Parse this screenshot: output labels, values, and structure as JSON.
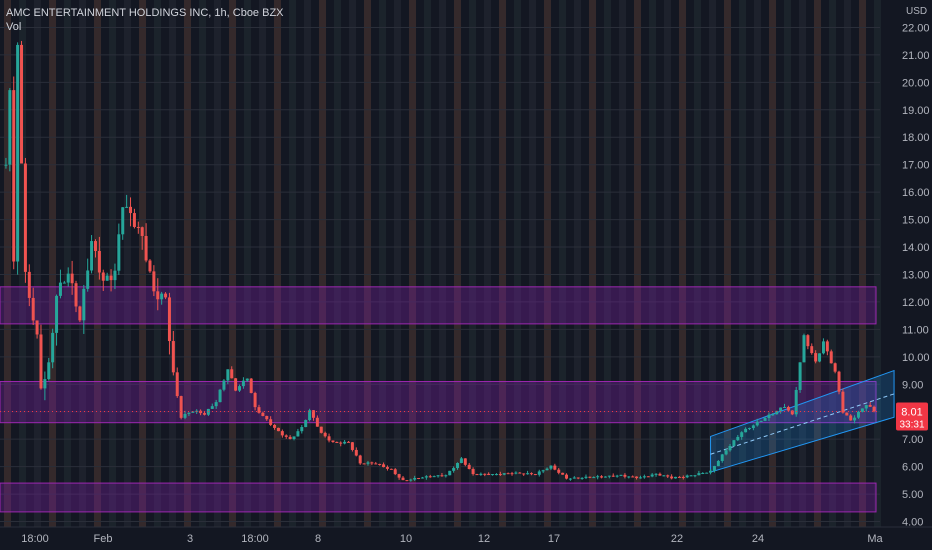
{
  "header": {
    "symbol_line": "AMC ENTERTAINMENT HOLDINGS INC, 1h, Cboe BZX",
    "volume_label": "Vol"
  },
  "currency_label": "USD",
  "price_badge": {
    "price": "8.01",
    "countdown": "33:31",
    "color": "#f23645"
  },
  "colors": {
    "background": "#131722",
    "up": "#26a69a",
    "down": "#ef5350",
    "zone_fill": "#7b1fa2",
    "zone_border": "#9c27b0",
    "channel": "#2196f3",
    "axis_text": "#b2b5be",
    "session_stripe": "#5d4037"
  },
  "chart_data": {
    "type": "candlestick",
    "title": "AMC ENTERTAINMENT HOLDINGS INC, 1h, Cboe BZX",
    "ylim": [
      3.8,
      23.0
    ],
    "y_ticks": [
      "4.00",
      "5.00",
      "6.00",
      "7.00",
      "8.00",
      "9.00",
      "10.00",
      "11.00",
      "12.00",
      "13.00",
      "14.00",
      "15.00",
      "16.00",
      "17.00",
      "18.00",
      "19.00",
      "20.00",
      "21.00",
      "22.00"
    ],
    "x_ticks": [
      "18:00",
      "Feb",
      "3",
      "18:00",
      "8",
      "10",
      "12",
      "17",
      "22",
      "24",
      "Ma"
    ],
    "current_price": 8.01,
    "zones": [
      {
        "low": 11.2,
        "high": 12.55
      },
      {
        "low": 7.6,
        "high": 9.1
      },
      {
        "low": 4.35,
        "high": 5.4
      }
    ],
    "channel": {
      "lower_start": 5.8,
      "lower_end": 7.8,
      "upper_start": 7.1,
      "upper_end": 9.5
    },
    "anchors": [
      {
        "t": 0,
        "p": 17.0
      },
      {
        "t": 1,
        "p": 19.8
      },
      {
        "t": 2,
        "p": 13.2
      },
      {
        "t": 3,
        "p": 21.2
      },
      {
        "t": 5,
        "p": 12.8
      },
      {
        "t": 8,
        "p": 10.7
      },
      {
        "t": 9,
        "p": 9.0
      },
      {
        "t": 11,
        "p": 9.8
      },
      {
        "t": 13,
        "p": 12.4
      },
      {
        "t": 16,
        "p": 13.0
      },
      {
        "t": 19,
        "p": 11.2
      },
      {
        "t": 22,
        "p": 14.2
      },
      {
        "t": 25,
        "p": 12.9
      },
      {
        "t": 28,
        "p": 13.2
      },
      {
        "t": 30,
        "p": 15.6
      },
      {
        "t": 32,
        "p": 15.0
      },
      {
        "t": 35,
        "p": 14.2
      },
      {
        "t": 38,
        "p": 12.4
      },
      {
        "t": 41,
        "p": 12.3
      },
      {
        "t": 43,
        "p": 9.4
      },
      {
        "t": 45,
        "p": 7.8
      },
      {
        "t": 48,
        "p": 8.0
      },
      {
        "t": 51,
        "p": 7.9
      },
      {
        "t": 54,
        "p": 8.4
      },
      {
        "t": 57,
        "p": 9.6
      },
      {
        "t": 59,
        "p": 8.8
      },
      {
        "t": 62,
        "p": 9.2
      },
      {
        "t": 64,
        "p": 8.1
      },
      {
        "t": 67,
        "p": 7.7
      },
      {
        "t": 70,
        "p": 7.3
      },
      {
        "t": 73,
        "p": 7.0
      },
      {
        "t": 76,
        "p": 7.4
      },
      {
        "t": 78,
        "p": 8.0
      },
      {
        "t": 81,
        "p": 7.2
      },
      {
        "t": 84,
        "p": 6.9
      },
      {
        "t": 88,
        "p": 6.9
      },
      {
        "t": 91,
        "p": 6.1
      },
      {
        "t": 95,
        "p": 6.1
      },
      {
        "t": 99,
        "p": 5.9
      },
      {
        "t": 102,
        "p": 5.5
      },
      {
        "t": 108,
        "p": 5.6
      },
      {
        "t": 113,
        "p": 5.7
      },
      {
        "t": 117,
        "p": 6.3
      },
      {
        "t": 120,
        "p": 5.7
      },
      {
        "t": 125,
        "p": 5.7
      },
      {
        "t": 130,
        "p": 5.8
      },
      {
        "t": 136,
        "p": 5.7
      },
      {
        "t": 140,
        "p": 6.0
      },
      {
        "t": 144,
        "p": 5.6
      },
      {
        "t": 148,
        "p": 5.6
      },
      {
        "t": 153,
        "p": 5.6
      },
      {
        "t": 158,
        "p": 5.7
      },
      {
        "t": 163,
        "p": 5.6
      },
      {
        "t": 167,
        "p": 5.7
      },
      {
        "t": 171,
        "p": 5.6
      },
      {
        "t": 176,
        "p": 5.7
      },
      {
        "t": 181,
        "p": 5.8
      },
      {
        "t": 185,
        "p": 6.6
      },
      {
        "t": 189,
        "p": 7.3
      },
      {
        "t": 193,
        "p": 7.6
      },
      {
        "t": 197,
        "p": 7.9
      },
      {
        "t": 200,
        "p": 8.2
      },
      {
        "t": 202,
        "p": 7.9
      },
      {
        "t": 205,
        "p": 10.8
      },
      {
        "t": 208,
        "p": 9.8
      },
      {
        "t": 210,
        "p": 10.5
      },
      {
        "t": 213,
        "p": 9.4
      },
      {
        "t": 215,
        "p": 8.0
      },
      {
        "t": 217,
        "p": 7.7
      },
      {
        "t": 219,
        "p": 8.0
      },
      {
        "t": 221,
        "p": 8.3
      },
      {
        "t": 223,
        "p": 8.01
      }
    ]
  }
}
